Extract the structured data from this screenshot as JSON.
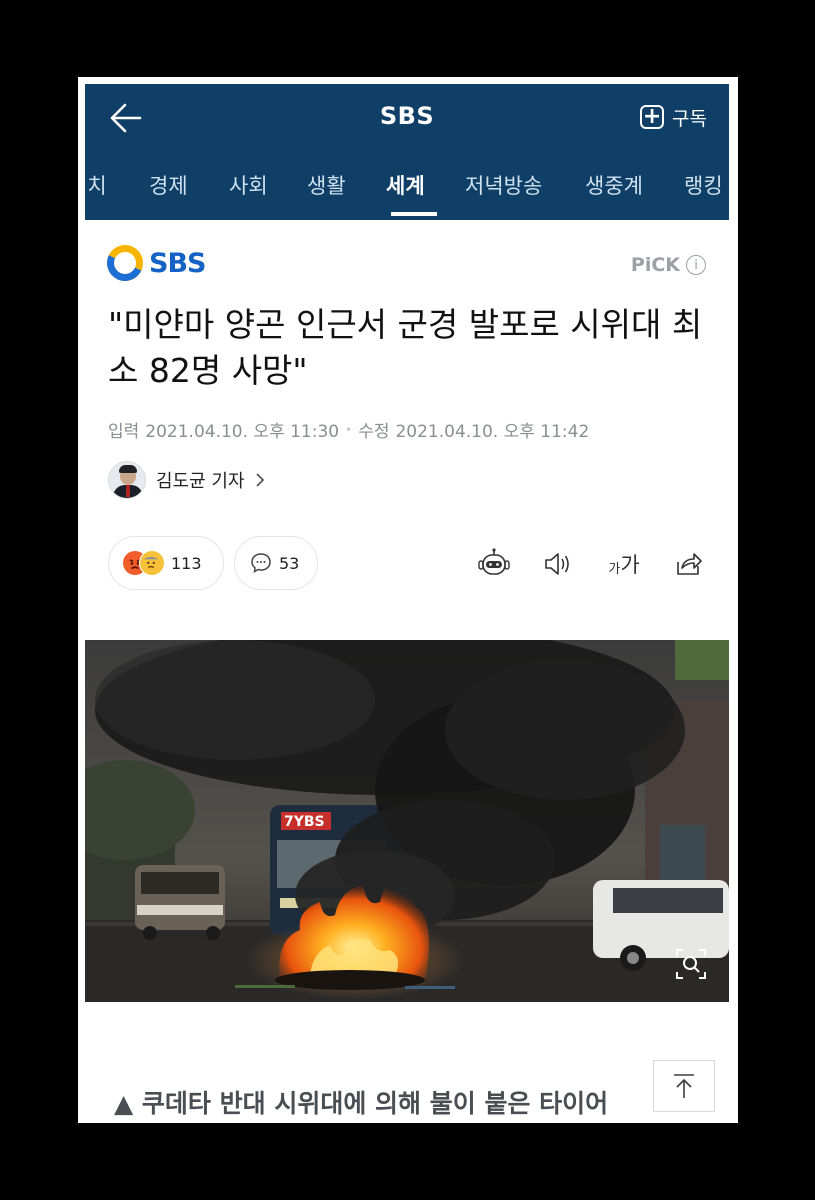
{
  "header": {
    "title": "SBS",
    "subscribe_label": "구독",
    "back_icon": "back-arrow-icon"
  },
  "tabs": [
    {
      "label": "정치"
    },
    {
      "label": "경제"
    },
    {
      "label": "사회"
    },
    {
      "label": "생활"
    },
    {
      "label": "세계",
      "active": true
    },
    {
      "label": "저녁방송"
    },
    {
      "label": "생중계"
    },
    {
      "label": "랭킹"
    }
  ],
  "article": {
    "publisher_logo_text": "SBS",
    "pick_label": "PiCK",
    "headline": "\"미얀마 양곤 인근서 군경 발포로 시위대 최소 82명 사망\"",
    "published_label": "입력",
    "published_at": "2021.04.10. 오후 11:30",
    "modified_label": "수정",
    "modified_at": "2021.04.10. 오후 11:42",
    "reporter": "김도균 기자",
    "caption": "▲ 쿠데타 반대 시위대에 의해 불이 붙은 타이어"
  },
  "reactions": {
    "emotion_count": "113",
    "comment_count": "53"
  },
  "toolbar": {
    "font_size_small": "가",
    "font_size_large": "가"
  },
  "photo": {
    "bus_sign": "7YBS"
  },
  "colors": {
    "header_bg": "#0f3f66",
    "brand_blue": "#1462c4",
    "brand_yellow": "#f7b500"
  }
}
